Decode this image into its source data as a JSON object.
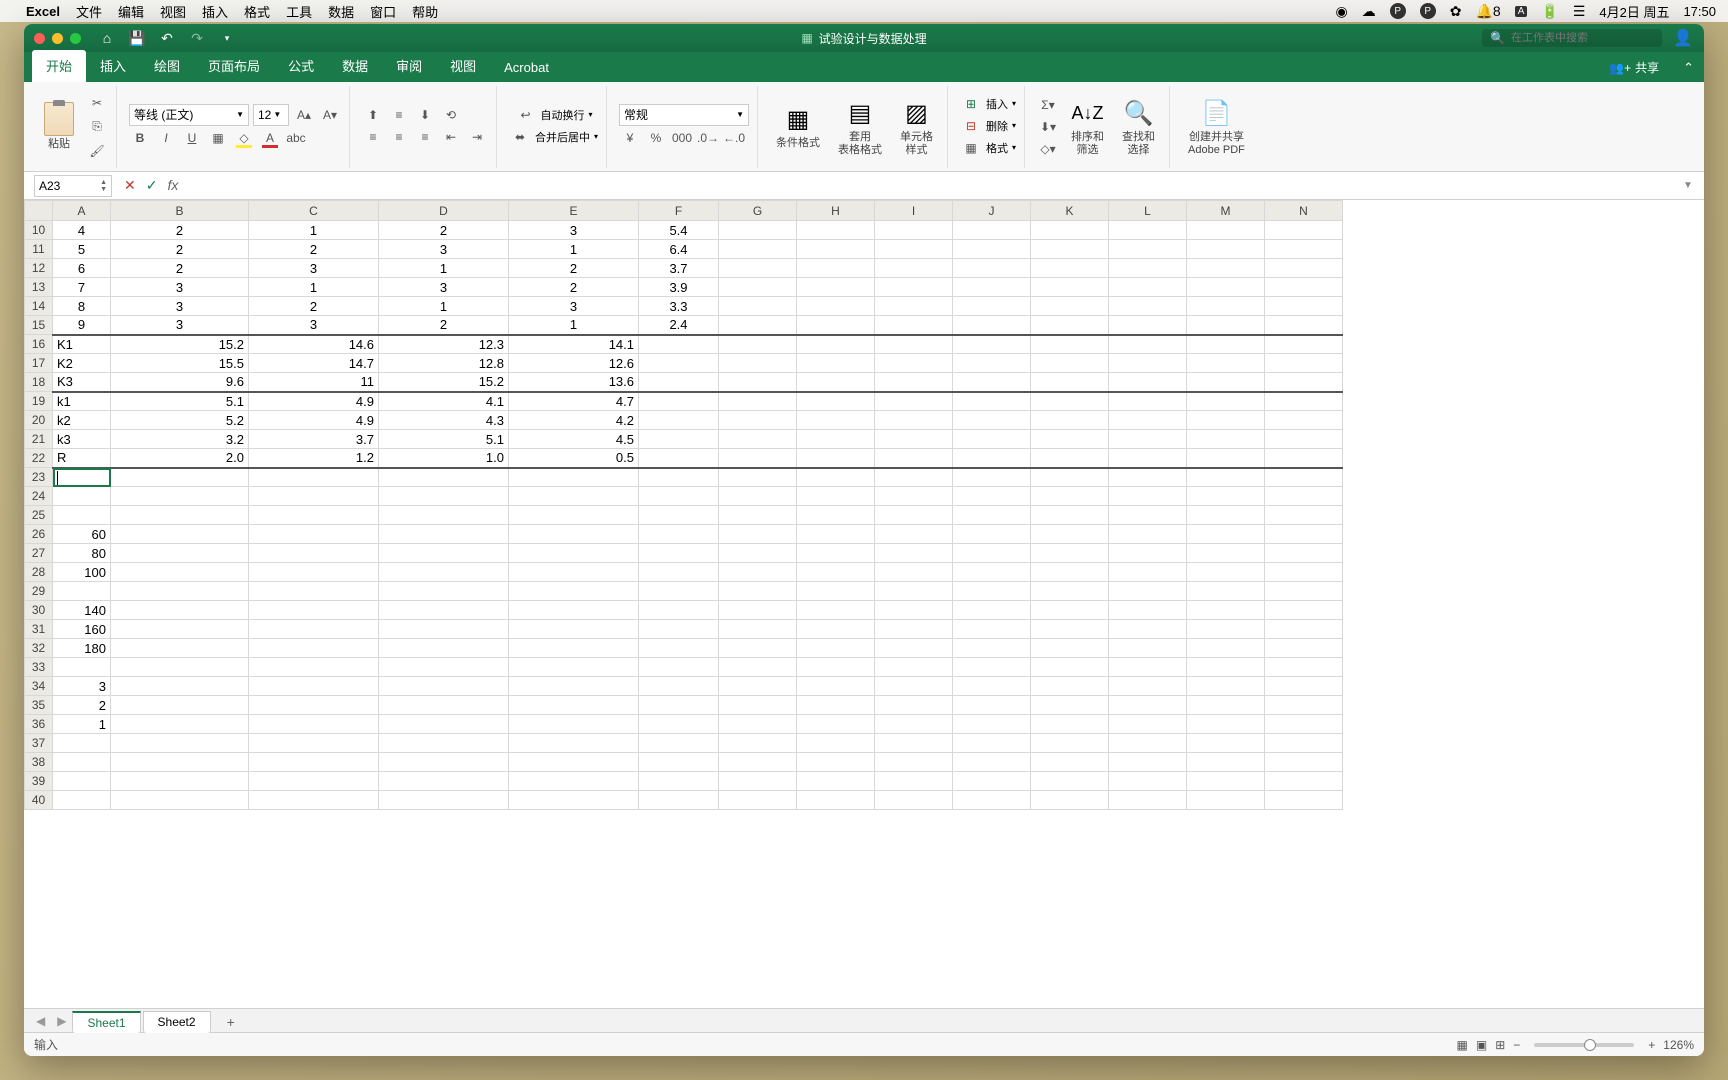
{
  "menubar": {
    "app": "Excel",
    "items": [
      "文件",
      "编辑",
      "视图",
      "插入",
      "格式",
      "工具",
      "数据",
      "窗口",
      "帮助"
    ],
    "notif_count": "8",
    "date": "4月2日 周五",
    "time": "17:50"
  },
  "titlebar": {
    "doc_title": "试验设计与数据处理",
    "search_placeholder": "在工作表中搜索"
  },
  "ribbon_tabs": [
    "开始",
    "插入",
    "绘图",
    "页面布局",
    "公式",
    "数据",
    "审阅",
    "视图",
    "Acrobat"
  ],
  "share_label": "共享",
  "ribbon": {
    "paste_label": "粘贴",
    "font_name": "等线 (正文)",
    "font_size": "12",
    "wrap_label": "自动换行",
    "merge_label": "合并后居中",
    "number_format": "常规",
    "cond_fmt": "条件格式",
    "table_fmt": "套用\n表格格式",
    "cell_style": "单元格\n样式",
    "insert": "插入",
    "delete": "删除",
    "format": "格式",
    "sort_filter": "排序和\n筛选",
    "find_select": "查找和\n选择",
    "adobe_pdf": "创建并共享\nAdobe PDF"
  },
  "name_box": "A23",
  "formula": "",
  "columns": [
    "A",
    "B",
    "C",
    "D",
    "E",
    "F",
    "G",
    "H",
    "I",
    "J",
    "K",
    "L",
    "M",
    "N"
  ],
  "first_row": 10,
  "last_row": 40,
  "col_widths": {
    "A": "col-A",
    "B": "col-B",
    "C": "col-C",
    "D": "col-D",
    "E": "col-E",
    "F": "col-F"
  },
  "cells": {
    "10": {
      "A": {
        "v": "4",
        "a": "center"
      },
      "B": {
        "v": "2",
        "a": "center"
      },
      "C": {
        "v": "1",
        "a": "center"
      },
      "D": {
        "v": "2",
        "a": "center"
      },
      "E": {
        "v": "3",
        "a": "center"
      },
      "F": {
        "v": "5.4",
        "a": "center"
      }
    },
    "11": {
      "A": {
        "v": "5",
        "a": "center"
      },
      "B": {
        "v": "2",
        "a": "center"
      },
      "C": {
        "v": "2",
        "a": "center"
      },
      "D": {
        "v": "3",
        "a": "center"
      },
      "E": {
        "v": "1",
        "a": "center"
      },
      "F": {
        "v": "6.4",
        "a": "center"
      }
    },
    "12": {
      "A": {
        "v": "6",
        "a": "center"
      },
      "B": {
        "v": "2",
        "a": "center"
      },
      "C": {
        "v": "3",
        "a": "center"
      },
      "D": {
        "v": "1",
        "a": "center"
      },
      "E": {
        "v": "2",
        "a": "center"
      },
      "F": {
        "v": "3.7",
        "a": "center"
      }
    },
    "13": {
      "A": {
        "v": "7",
        "a": "center"
      },
      "B": {
        "v": "3",
        "a": "center"
      },
      "C": {
        "v": "1",
        "a": "center"
      },
      "D": {
        "v": "3",
        "a": "center"
      },
      "E": {
        "v": "2",
        "a": "center"
      },
      "F": {
        "v": "3.9",
        "a": "center"
      }
    },
    "14": {
      "A": {
        "v": "8",
        "a": "center"
      },
      "B": {
        "v": "3",
        "a": "center"
      },
      "C": {
        "v": "2",
        "a": "center"
      },
      "D": {
        "v": "1",
        "a": "center"
      },
      "E": {
        "v": "3",
        "a": "center"
      },
      "F": {
        "v": "3.3",
        "a": "center"
      }
    },
    "15": {
      "A": {
        "v": "9",
        "a": "center"
      },
      "B": {
        "v": "3",
        "a": "center"
      },
      "C": {
        "v": "3",
        "a": "center"
      },
      "D": {
        "v": "2",
        "a": "center"
      },
      "E": {
        "v": "1",
        "a": "center"
      },
      "F": {
        "v": "2.4",
        "a": "center"
      }
    },
    "16": {
      "A": {
        "v": "K1",
        "a": "left"
      },
      "B": {
        "v": "15.2",
        "a": "num"
      },
      "C": {
        "v": "14.6",
        "a": "num"
      },
      "D": {
        "v": "12.3",
        "a": "num"
      },
      "E": {
        "v": "14.1",
        "a": "num"
      }
    },
    "17": {
      "A": {
        "v": "K2",
        "a": "left"
      },
      "B": {
        "v": "15.5",
        "a": "num"
      },
      "C": {
        "v": "14.7",
        "a": "num"
      },
      "D": {
        "v": "12.8",
        "a": "num"
      },
      "E": {
        "v": "12.6",
        "a": "num"
      }
    },
    "18": {
      "A": {
        "v": "K3",
        "a": "left"
      },
      "B": {
        "v": "9.6",
        "a": "num"
      },
      "C": {
        "v": "11",
        "a": "num"
      },
      "D": {
        "v": "15.2",
        "a": "num"
      },
      "E": {
        "v": "13.6",
        "a": "num"
      }
    },
    "19": {
      "A": {
        "v": "k1",
        "a": "left"
      },
      "B": {
        "v": "5.1",
        "a": "num"
      },
      "C": {
        "v": "4.9",
        "a": "num"
      },
      "D": {
        "v": "4.1",
        "a": "num"
      },
      "E": {
        "v": "4.7",
        "a": "num"
      }
    },
    "20": {
      "A": {
        "v": "k2",
        "a": "left"
      },
      "B": {
        "v": "5.2",
        "a": "num"
      },
      "C": {
        "v": "4.9",
        "a": "num"
      },
      "D": {
        "v": "4.3",
        "a": "num"
      },
      "E": {
        "v": "4.2",
        "a": "num"
      }
    },
    "21": {
      "A": {
        "v": "k3",
        "a": "left"
      },
      "B": {
        "v": "3.2",
        "a": "num"
      },
      "C": {
        "v": "3.7",
        "a": "num"
      },
      "D": {
        "v": "5.1",
        "a": "num"
      },
      "E": {
        "v": "4.5",
        "a": "num"
      }
    },
    "22": {
      "A": {
        "v": "R",
        "a": "left"
      },
      "B": {
        "v": "2.0",
        "a": "num"
      },
      "C": {
        "v": "1.2",
        "a": "num"
      },
      "D": {
        "v": "1.0",
        "a": "num"
      },
      "E": {
        "v": "0.5",
        "a": "num"
      }
    },
    "26": {
      "A": {
        "v": "60",
        "a": "num"
      }
    },
    "27": {
      "A": {
        "v": "80",
        "a": "num"
      }
    },
    "28": {
      "A": {
        "v": "100",
        "a": "num"
      }
    },
    "30": {
      "A": {
        "v": "140",
        "a": "num"
      }
    },
    "31": {
      "A": {
        "v": "160",
        "a": "num"
      }
    },
    "32": {
      "A": {
        "v": "180",
        "a": "num"
      }
    },
    "34": {
      "A": {
        "v": "3",
        "a": "num"
      }
    },
    "35": {
      "A": {
        "v": "2",
        "a": "num"
      }
    },
    "36": {
      "A": {
        "v": "1",
        "a": "num"
      }
    }
  },
  "thick_bottom_rows": [
    15,
    18,
    22
  ],
  "active_cell": {
    "row": 23,
    "col": "A"
  },
  "sheet_tabs": [
    {
      "name": "Sheet1",
      "active": true
    },
    {
      "name": "Sheet2",
      "active": false
    }
  ],
  "status_mode": "输入",
  "zoom": "126%"
}
